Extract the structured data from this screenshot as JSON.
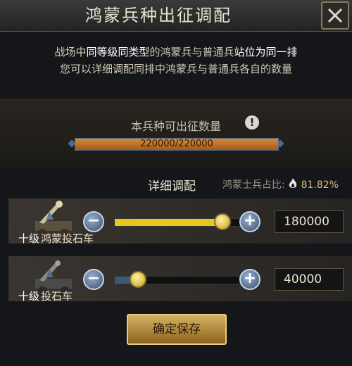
{
  "title": "鸿蒙兵种出征调配",
  "description": {
    "line1_parts": [
      "战场中",
      "同等级同类型",
      "的鸿蒙兵与普通兵",
      "站位为同一排"
    ],
    "line2": "您可以详细调配同排中鸿蒙兵与普通兵各自的数量"
  },
  "capacity": {
    "label": "本兵种可出征数量",
    "value_text": "220000/220000",
    "fill_fraction": 1.0
  },
  "detail": {
    "title": "详细调配",
    "ratio_label": "鸿蒙士兵占比:",
    "ratio_value": "81.82%"
  },
  "units": [
    {
      "rank": "十级",
      "name": "鸿蒙投石车",
      "quantity": "180000",
      "slider_fraction": 0.818,
      "fill_color": "#e8c820"
    },
    {
      "rank": "十级",
      "name": "投石车",
      "quantity": "40000",
      "slider_fraction": 0.182,
      "fill_color": "#3a5a7a"
    }
  ],
  "buttons": {
    "minus": "−",
    "plus": "+",
    "confirm": "确定保存"
  },
  "icons": {
    "close": "close-icon",
    "warning": "!"
  }
}
